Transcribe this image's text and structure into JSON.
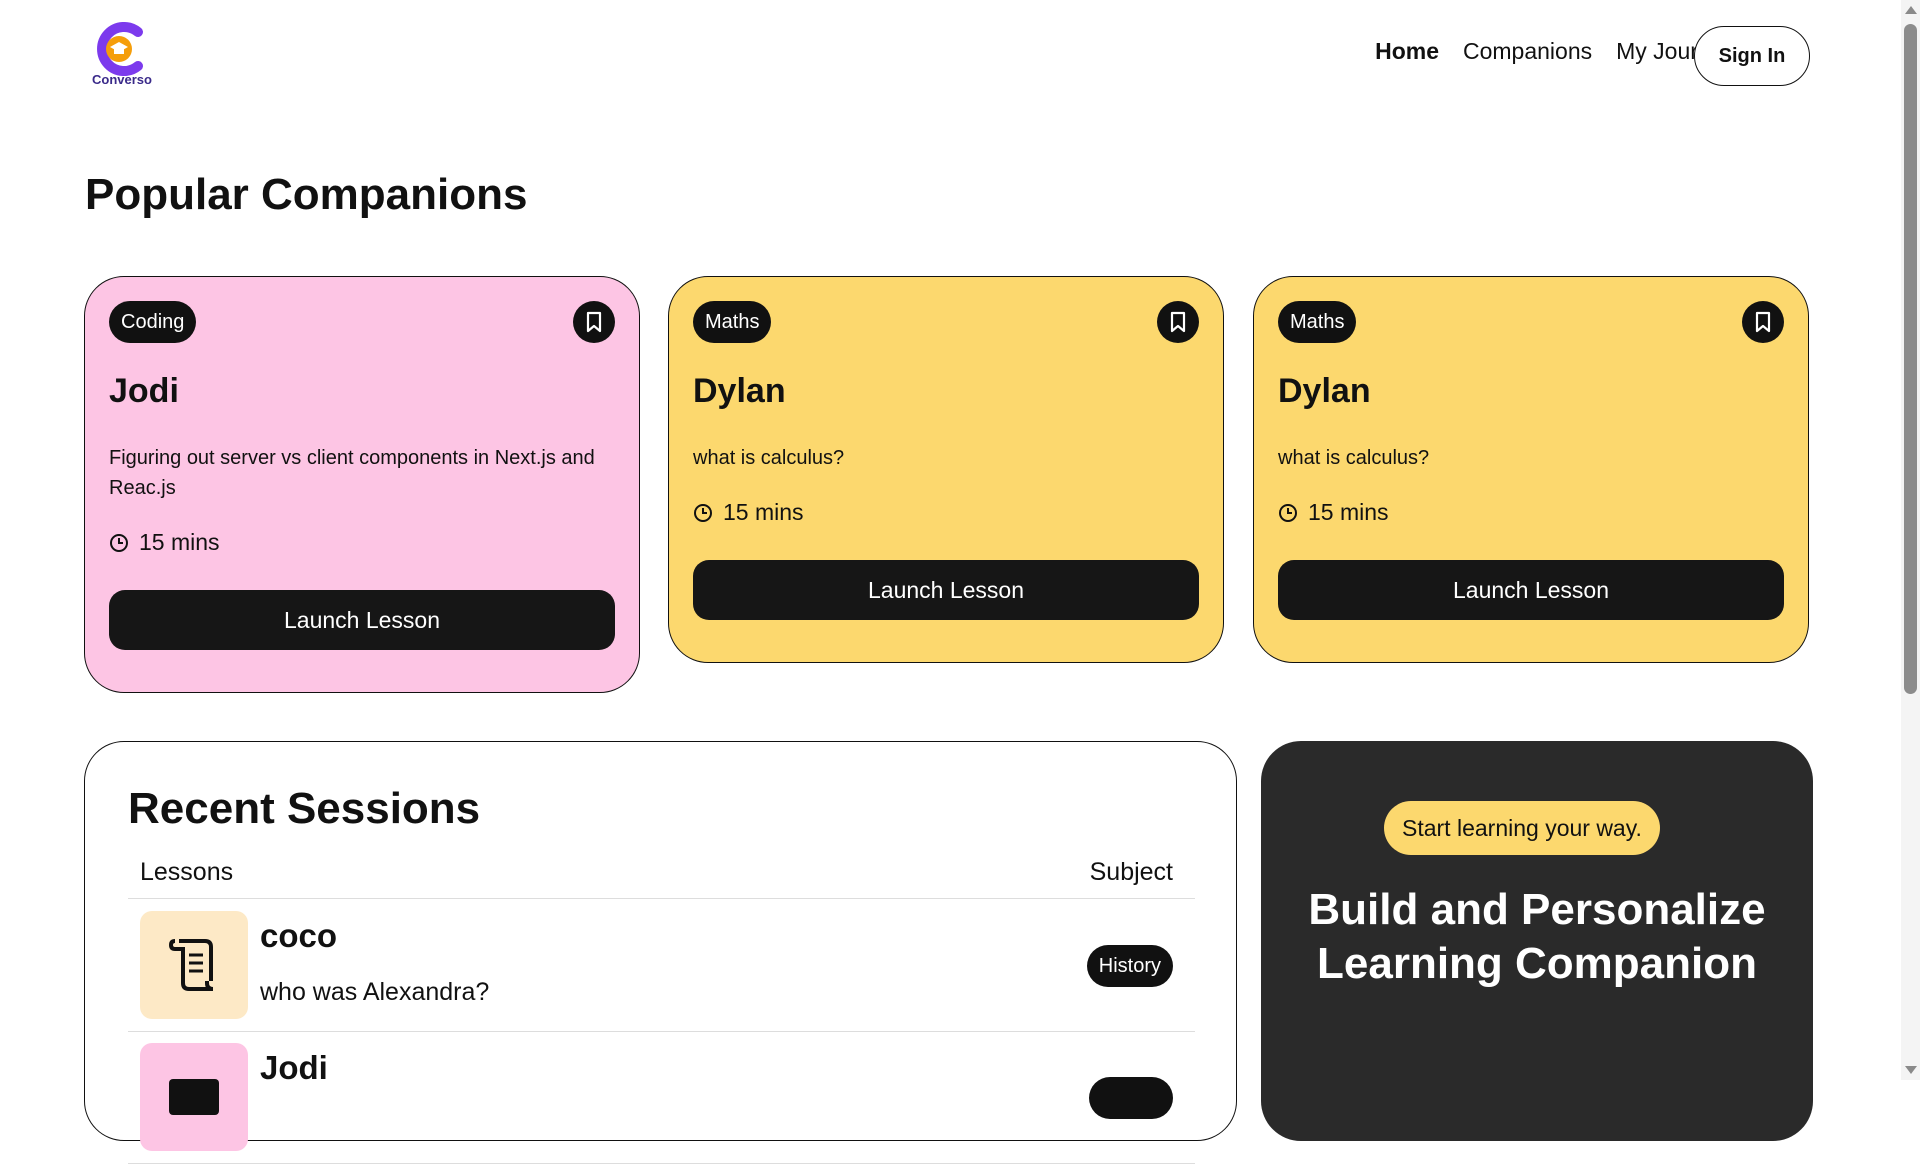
{
  "brand": {
    "name": "Converso"
  },
  "nav": {
    "links": [
      {
        "label": "Home"
      },
      {
        "label": "Companions"
      },
      {
        "label": "My Journey"
      }
    ],
    "signin_label": "Sign In"
  },
  "popular": {
    "title": "Popular Companions",
    "cards": [
      {
        "subject": "Coding",
        "name": "Jodi",
        "topic": "Figuring out server vs client components in Next.js and Reac.js",
        "duration": "15 mins",
        "launch_label": "Launch Lesson",
        "color": "#fdc5e4"
      },
      {
        "subject": "Maths",
        "name": "Dylan",
        "topic": "what is calculus?",
        "duration": "15 mins",
        "launch_label": "Launch Lesson",
        "color": "#fcd86e"
      },
      {
        "subject": "Maths",
        "name": "Dylan",
        "topic": "what is calculus?",
        "duration": "15 mins",
        "launch_label": "Launch Lesson",
        "color": "#fcd86e"
      }
    ]
  },
  "recent": {
    "title": "Recent Sessions",
    "columns": {
      "lessons": "Lessons",
      "subject": "Subject"
    },
    "rows": [
      {
        "name": "coco",
        "topic": "who was Alexandra?",
        "subject": "History",
        "icon": "scroll-icon",
        "icon_bg": "#fde9c6"
      },
      {
        "name": "Jodi",
        "topic": "",
        "subject": "",
        "icon": "code-icon",
        "icon_bg": "#fdc5e4"
      }
    ]
  },
  "cta": {
    "pill": "Start learning your way.",
    "title": "Build and Personalize Learning Companion"
  },
  "colors": {
    "accent_yellow": "#fcd86e",
    "accent_pink": "#fdc5e4",
    "dark": "#111111",
    "cta_bg": "#2a2a2a"
  }
}
